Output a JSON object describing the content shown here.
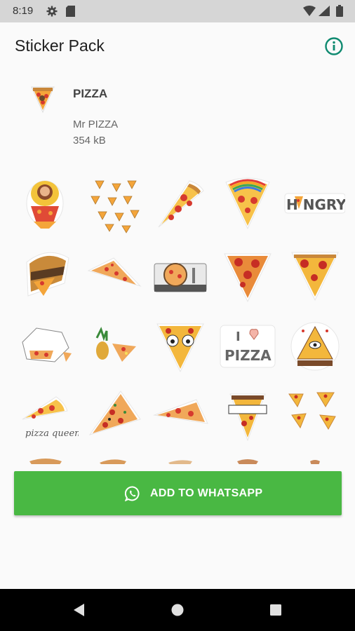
{
  "status_bar": {
    "time": "8:19"
  },
  "app_bar": {
    "title": "Sticker Pack",
    "info_icon": "info-icon"
  },
  "pack": {
    "name": "PIZZA",
    "publisher": "Mr PIZZA",
    "size": "354 kB"
  },
  "stickers": {
    "row1": [
      "jesus-pizza-sticker",
      "pizza-slices-pattern-sticker",
      "pepperoni-slice-sticker",
      "rainbow-pizza-sticker",
      "hangry-sticker"
    ],
    "hangry_text": "H NGRY",
    "row2": [
      "pizza-scroll-sticker",
      "flat-slice-sticker",
      "pizza-turntable-sticker",
      "pepperoni-triangle-sticker",
      "pepperoni-triangle-sticker-2"
    ],
    "row3": [
      "pizza-box-sticker",
      "pineapple-pizza-sticker",
      "googly-eyes-pizza-sticker",
      "i-love-pizza-sticker",
      "illuminati-pizza-sticker"
    ],
    "i_love_text_1": "I",
    "i_love_text_2": "PIZZA",
    "row4": [
      "pizza-queen-sticker",
      "supreme-slice-sticker",
      "long-slice-sticker",
      "pizza-dude-sticker",
      "mini-slices-sticker"
    ],
    "pizza_queen_text": "pizza queen"
  },
  "actions": {
    "add_label": "ADD TO WHATSAPP",
    "add_icon": "whatsapp-icon"
  },
  "nav_bar": {
    "back": "back-icon",
    "home": "home-icon",
    "recents": "recents-icon"
  },
  "colors": {
    "accent": "#0f8a70",
    "button": "#49b843",
    "status_bar": "#d6d6d6"
  }
}
